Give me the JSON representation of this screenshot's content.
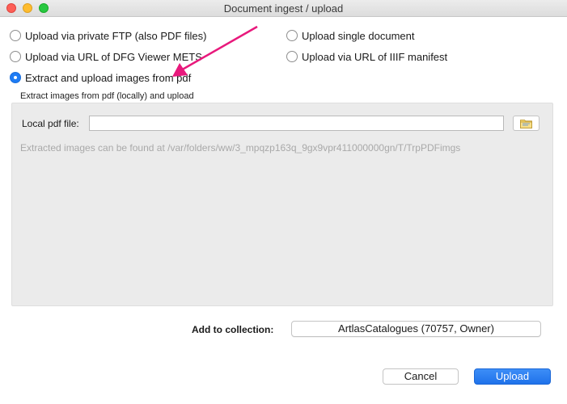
{
  "window": {
    "title": "Document ingest / upload"
  },
  "options": {
    "private_ftp": "Upload via private FTP (also PDF files)",
    "dfg_mets": "Upload via URL of DFG Viewer METS",
    "extract_pdf": "Extract and upload images from pdf",
    "single_document": "Upload single document",
    "iiif_manifest": "Upload via URL of IIIF manifest",
    "selected": "extract_pdf"
  },
  "pdf_group": {
    "title": "Extract images from pdf (locally) and upload",
    "local_file_label": "Local pdf file:",
    "local_file_value": "",
    "hint": "Extracted images can be found at /var/folders/ww/3_mpqzp163q_9gx9vpr411000000gn/T/TrpPDFimgs"
  },
  "collection": {
    "label": "Add to collection:",
    "value": "ArtlasCatalogues (70757, Owner)"
  },
  "buttons": {
    "cancel": "Cancel",
    "upload": "Upload"
  },
  "colors": {
    "accent": "#1e7cf5",
    "annotation_arrow": "#e8197c"
  }
}
